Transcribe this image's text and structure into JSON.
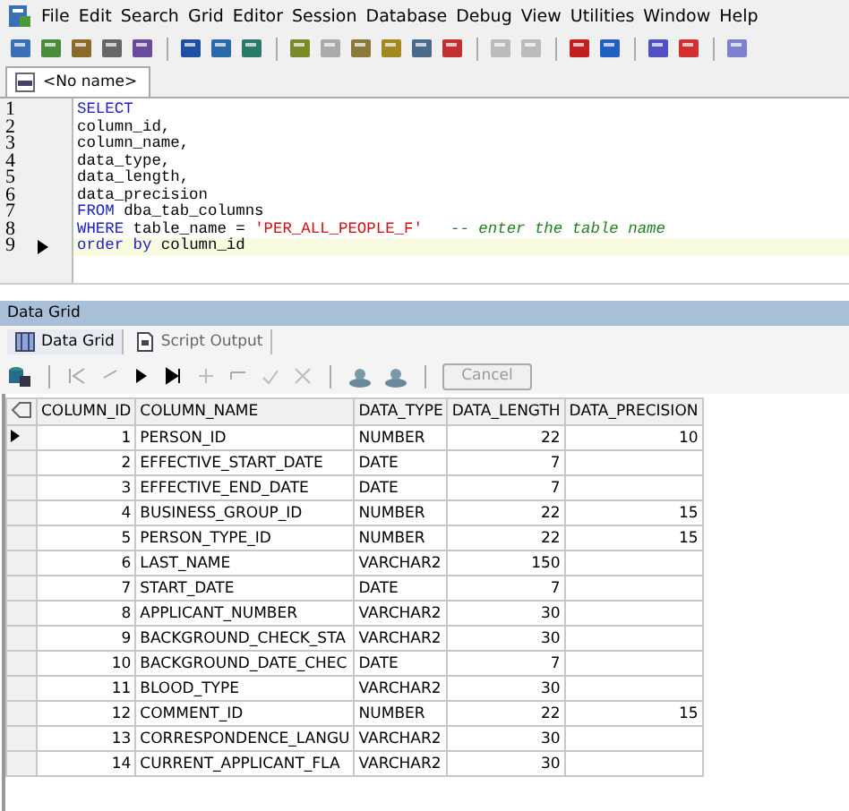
{
  "menu": [
    "File",
    "Edit",
    "Search",
    "Grid",
    "Editor",
    "Session",
    "Database",
    "Debug",
    "View",
    "Utilities",
    "Window",
    "Help"
  ],
  "document_tab": {
    "label": "<No name>",
    "selected": true
  },
  "editor": {
    "lines": [
      {
        "number": "1",
        "current": false,
        "tokens": [
          {
            "kind": "keyword",
            "text": "SELECT"
          }
        ]
      },
      {
        "number": "2",
        "current": false,
        "tokens": [
          {
            "kind": "plain",
            "text": "column_id,"
          }
        ]
      },
      {
        "number": "3",
        "current": false,
        "tokens": [
          {
            "kind": "plain",
            "text": "column_name,"
          }
        ]
      },
      {
        "number": "4",
        "current": false,
        "tokens": [
          {
            "kind": "plain",
            "text": "data_type,"
          }
        ]
      },
      {
        "number": "5",
        "current": false,
        "tokens": [
          {
            "kind": "plain",
            "text": "data_length,"
          }
        ]
      },
      {
        "number": "6",
        "current": false,
        "tokens": [
          {
            "kind": "plain",
            "text": "data_precision"
          }
        ]
      },
      {
        "number": "7",
        "current": false,
        "tokens": [
          {
            "kind": "keyword",
            "text": "FROM"
          },
          {
            "kind": "plain",
            "text": " dba_tab_columns"
          }
        ]
      },
      {
        "number": "8",
        "current": false,
        "tokens": [
          {
            "kind": "keyword",
            "text": "WHERE"
          },
          {
            "kind": "plain",
            "text": " table_name = "
          },
          {
            "kind": "string",
            "text": "'PER_ALL_PEOPLE_F'"
          },
          {
            "kind": "comment",
            "text": "-- enter the table name"
          }
        ]
      },
      {
        "number": "9",
        "current": true,
        "tokens": [
          {
            "kind": "keyword",
            "text": "order by"
          },
          {
            "kind": "plain",
            "text": " column_id"
          }
        ]
      }
    ]
  },
  "results_panel": {
    "title": "Data Grid",
    "tabs": [
      {
        "label": "Data Grid",
        "selected": true
      },
      {
        "label": "Script Output",
        "selected": false
      }
    ],
    "cancel_button": {
      "label": "Cancel",
      "disabled": true
    },
    "columns": [
      "COLUMN_ID",
      "COLUMN_NAME",
      "DATA_TYPE",
      "DATA_LENGTH",
      "DATA_PRECISION"
    ],
    "rows": [
      {
        "current": true,
        "cells": [
          "1",
          "PERSON_ID",
          "NUMBER",
          "22",
          "10"
        ]
      },
      {
        "current": false,
        "cells": [
          "2",
          "EFFECTIVE_START_DATE",
          "DATE",
          "7"
        ]
      },
      {
        "current": false,
        "cells": [
          "3",
          "EFFECTIVE_END_DATE",
          "DATE",
          "7"
        ]
      },
      {
        "current": false,
        "cells": [
          "4",
          "BUSINESS_GROUP_ID",
          "NUMBER",
          "22",
          "15"
        ]
      },
      {
        "current": false,
        "cells": [
          "5",
          "PERSON_TYPE_ID",
          "NUMBER",
          "22",
          "15"
        ]
      },
      {
        "current": false,
        "cells": [
          "6",
          "LAST_NAME",
          "VARCHAR2",
          "150"
        ]
      },
      {
        "current": false,
        "cells": [
          "7",
          "START_DATE",
          "DATE",
          "7"
        ]
      },
      {
        "current": false,
        "cells": [
          "8",
          "APPLICANT_NUMBER",
          "VARCHAR2",
          "30"
        ]
      },
      {
        "current": false,
        "cells": [
          "9",
          "BACKGROUND_CHECK_STA",
          "VARCHAR2",
          "30"
        ]
      },
      {
        "current": false,
        "cells": [
          "10",
          "BACKGROUND_DATE_CHEC",
          "DATE",
          "7"
        ]
      },
      {
        "current": false,
        "cells": [
          "11",
          "BLOOD_TYPE",
          "VARCHAR2",
          "30"
        ]
      },
      {
        "current": false,
        "cells": [
          "12",
          "COMMENT_ID",
          "NUMBER",
          "22",
          "15"
        ]
      },
      {
        "current": false,
        "cells": [
          "13",
          "CORRESPONDENCE_LANGU",
          "VARCHAR2",
          "30"
        ]
      },
      {
        "current": false,
        "cells": [
          "14",
          "CURRENT_APPLICANT_FLA",
          "VARCHAR2",
          "30"
        ]
      }
    ]
  }
}
